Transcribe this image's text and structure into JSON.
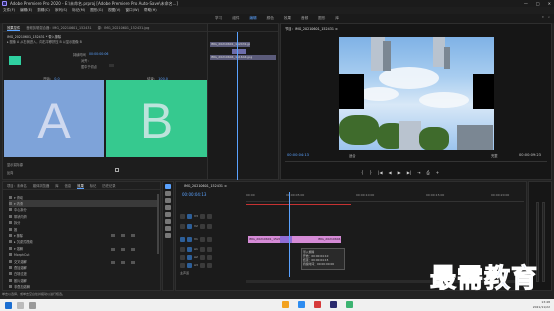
{
  "window": {
    "title": "Adobe Premiere Pro 2020 - E:\\未命名.prproj [Adobe Premiere Pro Auto-Save\\未命名...]",
    "controls": [
      "—",
      "□",
      "✕"
    ]
  },
  "menu": [
    "文件(F)",
    "编辑(E)",
    "剪辑(C)",
    "序列(S)",
    "标记(M)",
    "图形(G)",
    "视图(V)",
    "窗口(W)",
    "帮助(H)"
  ],
  "workspaces": {
    "items": [
      "学习",
      "组件",
      "编辑",
      "颜色",
      "效果",
      "音频",
      "图形",
      "库"
    ],
    "active": "编辑"
  },
  "effect_controls": {
    "tabs": [
      "效果控件",
      "音频剪辑混合器：IMG_20210601_152431",
      "源：IMG_20210601_152431.jpg"
    ],
    "active_tab": "效果控件",
    "clip_header": "IMG_20210601_152431 * 带入擦除",
    "description": "▸ 图像 A 从右侧进入，向右平移挤压 B 以显示图像 B",
    "duration_label": "持续时间",
    "duration_value": "00:00:00:06",
    "align_label": "对齐：",
    "align_value": "居中于切点",
    "a_label": "开始：",
    "a_value": "0.0",
    "b_label": "结束：",
    "b_value": "100.0",
    "a_letter": "A",
    "b_letter": "B",
    "show_actual": "显示实际源",
    "reverse": "反向"
  },
  "ec_timeline": {
    "clips": [
      "IMG_20210601_152431.jpg",
      "IMG_20210601_152431.jpg",
      "IMG_20210604_151644.jpg"
    ],
    "footer": "00:00:04:13"
  },
  "program": {
    "tab": "节目：IMG_20210601_152431  ≡",
    "timecode": "00:00:04:13",
    "fit": "适合",
    "resolution": "完整",
    "duration": "00:00:09:23",
    "controls": [
      "{",
      "}",
      "|◀",
      "◀",
      "▶",
      "▶|",
      "⇥",
      "⎙",
      "+"
    ]
  },
  "effects_panel": {
    "tabs": [
      "项目：未命名",
      "媒体浏览器",
      "库",
      "信息",
      "效果",
      "标记",
      "历史记录"
    ],
    "active_tab": "效果",
    "items": [
      "▾ 滑动",
      "▾ 内滑",
      "  中心拆分",
      "  带状内滑",
      "  拆分",
      "  推",
      "▾ 擦除",
      "▸ 沉浸式视频",
      "▾ 溶解",
      "  MorphCut",
      "  交叉溶解",
      "  叠加溶解",
      "  白场过渡",
      "  胶片溶解",
      "  非叠加溶解",
      "  黑场过渡"
    ],
    "selected_index": 1
  },
  "timeline": {
    "tab": "IMG_20210601_152431  ≡",
    "timecode": "00:00:04:13",
    "ruler_ticks": [
      "00:00",
      "00:00:05:00",
      "00:00:10:00",
      "00:00:15:00",
      "00:00:20:00"
    ],
    "tracks": [
      "V3",
      "V2",
      "V1",
      "A1",
      "A2",
      "A3",
      "主声道"
    ],
    "clip1": "IMG_20210601_152431",
    "clip2": "IMG_20210604_151644",
    "tooltip_title": "带入擦除",
    "tooltip_lines": [
      "开始：00:00:04:10",
      "结束：00:00:04:15",
      "持续时间：00:00:00:06"
    ]
  },
  "status_bar": "单击以选择，或单击空白处并拖动以进行框选。",
  "taskbar": {
    "time": "13:48",
    "date": "2021/11/22"
  },
  "watermark": "最需教育"
}
